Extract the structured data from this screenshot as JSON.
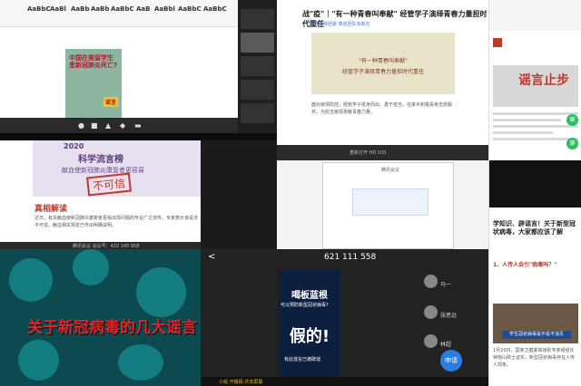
{
  "word": {
    "ribbon_buttons": [
      "AaBbC",
      "AaBl",
      "AaBb",
      "AaBb",
      "AaBbC",
      "AaB",
      "AaBbl",
      "AaBbC",
      "AaBbC"
    ],
    "poster_title": "中国在美留学生患新冠肺炎死亡?",
    "poster_stamp": "谣言"
  },
  "article": {
    "header": "战\"疫\"｜\"有一种青春叫奉献\" 经管学子演绎青春力量担时代重任",
    "meta": "经管学院团委  泰迪团队有新在",
    "banner_line1": "\"有一种青春叫奉献\"",
    "banner_line2": "经管学子演绎青春力量担时代重任",
    "para": "面对疫情防控，经管学子挺身而出、勇于担当，在家乡积极投身志愿服务，为抗击疫情贡献青春力量。",
    "status": "重新打开  HD  100"
  },
  "news_phone": {
    "big": "谣言止步",
    "chat_label": "聊"
  },
  "science": {
    "year": "2020",
    "title": "科学流言榜",
    "subtitle": "献血使新冠肺炎康复者更容易",
    "stamp": "不可信",
    "heading": "真相解读",
    "body": "近日，有关献血使新冠肺炎康复者更易出现问题的传言广泛流传，专家表示该说法不可信，献血相关规定已作出明确说明。",
    "status": "腾讯会议  会议号：420 145 958"
  },
  "chat_window": {
    "title": "腾讯会议"
  },
  "video": {
    "caption": "关于新冠病毒的几大谣言"
  },
  "meeting_phone": {
    "back": "<",
    "number": "621 111 558",
    "card_title": "喝板蓝根",
    "card_sub": "可以预防新型冠状病毒?",
    "card_big": "假的!",
    "card_foot": "有此谣言已被辟谣",
    "names": [
      "马一",
      "张思远",
      "林超"
    ],
    "apply": "申请",
    "footer": "小组  开播报-共享屏幕"
  },
  "article_phone": {
    "headline": "学知识、辟谣言！关于新型冠状病毒，大家都应该了解",
    "question": "1、人传人会引\"病毒吗？\"",
    "band": "学生冠状病毒是不是不消灭",
    "txt": "1月20日，国家卫健委高级别专家组组长钟南山院士证实，新型冠状病毒存在人传人现象。"
  }
}
